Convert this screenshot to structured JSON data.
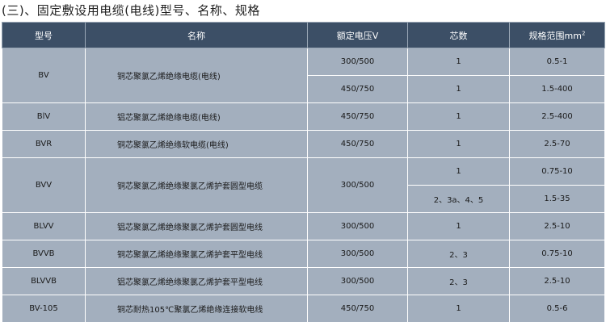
{
  "title": "(三)、固定敷设用电缆(电线)型号、名称、规格",
  "headers": {
    "model": "型号",
    "name": "名称",
    "voltage": "额定电压V",
    "cores": "芯数",
    "spec": "规格范围mm",
    "spec_sup": "2"
  },
  "rows": [
    {
      "model": "BV",
      "name": "铜芯聚氯乙烯绝缘电缆(电线)",
      "sub": [
        {
          "voltage": "300/500",
          "cores": "1",
          "spec": "0.5-1"
        },
        {
          "voltage": "450/750",
          "cores": "1",
          "spec": "1.5-400"
        }
      ]
    },
    {
      "model": "BlV",
      "name": "铝芯聚氯乙烯绝缘电缆(电线)",
      "sub": [
        {
          "voltage": "450/750",
          "cores": "1",
          "spec": "2.5-400"
        }
      ]
    },
    {
      "model": "BVR",
      "name": "铜芯聚氯乙烯绝缘软电缆(电线)",
      "sub": [
        {
          "voltage": "450/750",
          "cores": "1",
          "spec": "2.5-70"
        }
      ]
    },
    {
      "model": "BVV",
      "name": "铜芯聚氯乙烯绝缘聚氯乙烯护套圆型电缆",
      "voltage": "300/500",
      "sub": [
        {
          "cores": "1",
          "spec": "0.75-10"
        },
        {
          "cores": "2、3a、4、5",
          "spec": "1.5-35"
        }
      ]
    },
    {
      "model": "BLVV",
      "name": "铝芯聚氯乙烯绝缘聚氯乙烯护套圆型电线",
      "sub": [
        {
          "voltage": "300/500",
          "cores": "1",
          "spec": "2.5-10"
        }
      ]
    },
    {
      "model": "BVVB",
      "name": "铜芯聚氯乙烯绝缘聚氯乙烯护套平型电线",
      "sub": [
        {
          "voltage": "300/500",
          "cores": "2、3",
          "spec": "0.75-10"
        }
      ]
    },
    {
      "model": "BLVVB",
      "name": "铝芯聚氯乙烯绝缘聚氯乙烯护套平型电线",
      "sub": [
        {
          "voltage": "300/500",
          "cores": "2、3",
          "spec": "2.5-10"
        }
      ]
    },
    {
      "model": "BV-105",
      "name": "铜芯耐热105℃聚氯乙烯绝缘连接软电线",
      "sub": [
        {
          "voltage": "450/750",
          "cores": "1",
          "spec": "0.5-6"
        }
      ]
    }
  ]
}
